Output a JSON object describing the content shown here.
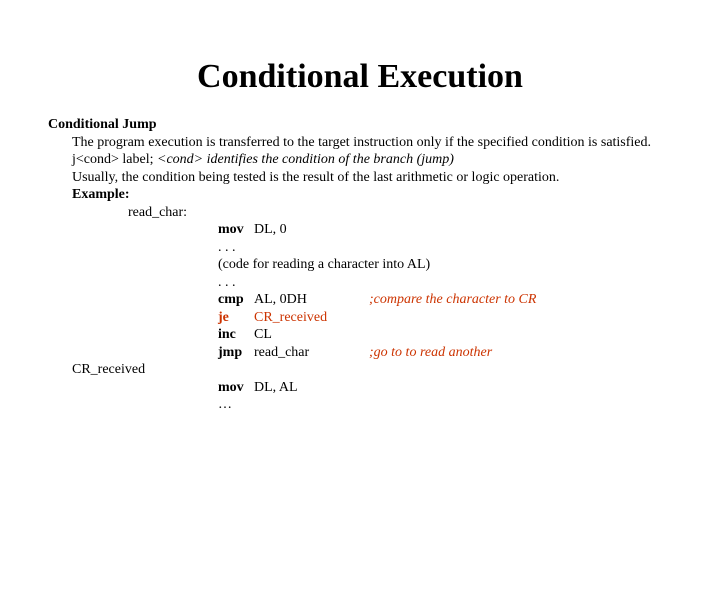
{
  "title": "Conditional Execution",
  "subhead": "Conditional Jump",
  "body_line1": "The program execution is transferred to the target instruction only if the specified condition is satisfied.",
  "jcond_prefix": "j<cond> label; ",
  "jcond_desc": "<cond> identifies the condition of the branch (jump)",
  "usually": "Usually, the condition being tested is the result of the last arithmetic or logic operation.",
  "example_label": "Example:",
  "label_read_char": "read_char:",
  "code": {
    "l1_op": "mov",
    "l1_args": "DL, 0",
    "l2": ". . .",
    "l3": "(code for reading a character into AL)",
    "l4": ". . .",
    "l5_op": "cmp",
    "l5_args": "AL, 0DH",
    "l5_comment": ";compare the character to CR",
    "l6_op": "je",
    "l6_args": "CR_received",
    "l7_op": "inc",
    "l7_args": "CL",
    "l8_op": "jmp",
    "l8_args": "read_char",
    "l8_comment": ";go to to read another"
  },
  "label_cr_received": "CR_received",
  "code2": {
    "l1_op": "mov",
    "l1_args": "DL, AL",
    "l2": "…"
  }
}
